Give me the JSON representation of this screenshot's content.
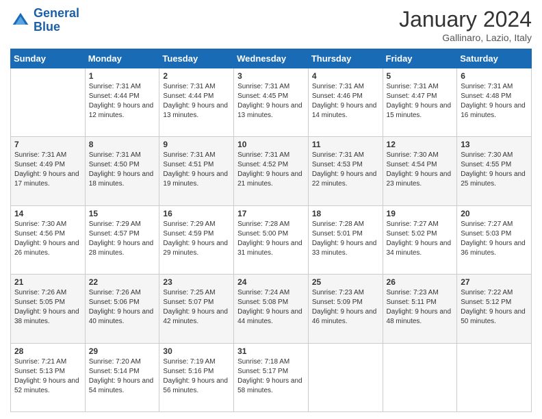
{
  "logo": {
    "line1": "General",
    "line2": "Blue"
  },
  "header": {
    "title": "January 2024",
    "subtitle": "Gallinaro, Lazio, Italy"
  },
  "weekdays": [
    "Sunday",
    "Monday",
    "Tuesday",
    "Wednesday",
    "Thursday",
    "Friday",
    "Saturday"
  ],
  "weeks": [
    [
      {
        "day": "",
        "sunrise": "",
        "sunset": "",
        "daylight": ""
      },
      {
        "day": "1",
        "sunrise": "Sunrise: 7:31 AM",
        "sunset": "Sunset: 4:44 PM",
        "daylight": "Daylight: 9 hours and 12 minutes."
      },
      {
        "day": "2",
        "sunrise": "Sunrise: 7:31 AM",
        "sunset": "Sunset: 4:44 PM",
        "daylight": "Daylight: 9 hours and 13 minutes."
      },
      {
        "day": "3",
        "sunrise": "Sunrise: 7:31 AM",
        "sunset": "Sunset: 4:45 PM",
        "daylight": "Daylight: 9 hours and 13 minutes."
      },
      {
        "day": "4",
        "sunrise": "Sunrise: 7:31 AM",
        "sunset": "Sunset: 4:46 PM",
        "daylight": "Daylight: 9 hours and 14 minutes."
      },
      {
        "day": "5",
        "sunrise": "Sunrise: 7:31 AM",
        "sunset": "Sunset: 4:47 PM",
        "daylight": "Daylight: 9 hours and 15 minutes."
      },
      {
        "day": "6",
        "sunrise": "Sunrise: 7:31 AM",
        "sunset": "Sunset: 4:48 PM",
        "daylight": "Daylight: 9 hours and 16 minutes."
      }
    ],
    [
      {
        "day": "7",
        "sunrise": "Sunrise: 7:31 AM",
        "sunset": "Sunset: 4:49 PM",
        "daylight": "Daylight: 9 hours and 17 minutes."
      },
      {
        "day": "8",
        "sunrise": "Sunrise: 7:31 AM",
        "sunset": "Sunset: 4:50 PM",
        "daylight": "Daylight: 9 hours and 18 minutes."
      },
      {
        "day": "9",
        "sunrise": "Sunrise: 7:31 AM",
        "sunset": "Sunset: 4:51 PM",
        "daylight": "Daylight: 9 hours and 19 minutes."
      },
      {
        "day": "10",
        "sunrise": "Sunrise: 7:31 AM",
        "sunset": "Sunset: 4:52 PM",
        "daylight": "Daylight: 9 hours and 21 minutes."
      },
      {
        "day": "11",
        "sunrise": "Sunrise: 7:31 AM",
        "sunset": "Sunset: 4:53 PM",
        "daylight": "Daylight: 9 hours and 22 minutes."
      },
      {
        "day": "12",
        "sunrise": "Sunrise: 7:30 AM",
        "sunset": "Sunset: 4:54 PM",
        "daylight": "Daylight: 9 hours and 23 minutes."
      },
      {
        "day": "13",
        "sunrise": "Sunrise: 7:30 AM",
        "sunset": "Sunset: 4:55 PM",
        "daylight": "Daylight: 9 hours and 25 minutes."
      }
    ],
    [
      {
        "day": "14",
        "sunrise": "Sunrise: 7:30 AM",
        "sunset": "Sunset: 4:56 PM",
        "daylight": "Daylight: 9 hours and 26 minutes."
      },
      {
        "day": "15",
        "sunrise": "Sunrise: 7:29 AM",
        "sunset": "Sunset: 4:57 PM",
        "daylight": "Daylight: 9 hours and 28 minutes."
      },
      {
        "day": "16",
        "sunrise": "Sunrise: 7:29 AM",
        "sunset": "Sunset: 4:59 PM",
        "daylight": "Daylight: 9 hours and 29 minutes."
      },
      {
        "day": "17",
        "sunrise": "Sunrise: 7:28 AM",
        "sunset": "Sunset: 5:00 PM",
        "daylight": "Daylight: 9 hours and 31 minutes."
      },
      {
        "day": "18",
        "sunrise": "Sunrise: 7:28 AM",
        "sunset": "Sunset: 5:01 PM",
        "daylight": "Daylight: 9 hours and 33 minutes."
      },
      {
        "day": "19",
        "sunrise": "Sunrise: 7:27 AM",
        "sunset": "Sunset: 5:02 PM",
        "daylight": "Daylight: 9 hours and 34 minutes."
      },
      {
        "day": "20",
        "sunrise": "Sunrise: 7:27 AM",
        "sunset": "Sunset: 5:03 PM",
        "daylight": "Daylight: 9 hours and 36 minutes."
      }
    ],
    [
      {
        "day": "21",
        "sunrise": "Sunrise: 7:26 AM",
        "sunset": "Sunset: 5:05 PM",
        "daylight": "Daylight: 9 hours and 38 minutes."
      },
      {
        "day": "22",
        "sunrise": "Sunrise: 7:26 AM",
        "sunset": "Sunset: 5:06 PM",
        "daylight": "Daylight: 9 hours and 40 minutes."
      },
      {
        "day": "23",
        "sunrise": "Sunrise: 7:25 AM",
        "sunset": "Sunset: 5:07 PM",
        "daylight": "Daylight: 9 hours and 42 minutes."
      },
      {
        "day": "24",
        "sunrise": "Sunrise: 7:24 AM",
        "sunset": "Sunset: 5:08 PM",
        "daylight": "Daylight: 9 hours and 44 minutes."
      },
      {
        "day": "25",
        "sunrise": "Sunrise: 7:23 AM",
        "sunset": "Sunset: 5:09 PM",
        "daylight": "Daylight: 9 hours and 46 minutes."
      },
      {
        "day": "26",
        "sunrise": "Sunrise: 7:23 AM",
        "sunset": "Sunset: 5:11 PM",
        "daylight": "Daylight: 9 hours and 48 minutes."
      },
      {
        "day": "27",
        "sunrise": "Sunrise: 7:22 AM",
        "sunset": "Sunset: 5:12 PM",
        "daylight": "Daylight: 9 hours and 50 minutes."
      }
    ],
    [
      {
        "day": "28",
        "sunrise": "Sunrise: 7:21 AM",
        "sunset": "Sunset: 5:13 PM",
        "daylight": "Daylight: 9 hours and 52 minutes."
      },
      {
        "day": "29",
        "sunrise": "Sunrise: 7:20 AM",
        "sunset": "Sunset: 5:14 PM",
        "daylight": "Daylight: 9 hours and 54 minutes."
      },
      {
        "day": "30",
        "sunrise": "Sunrise: 7:19 AM",
        "sunset": "Sunset: 5:16 PM",
        "daylight": "Daylight: 9 hours and 56 minutes."
      },
      {
        "day": "31",
        "sunrise": "Sunrise: 7:18 AM",
        "sunset": "Sunset: 5:17 PM",
        "daylight": "Daylight: 9 hours and 58 minutes."
      },
      {
        "day": "",
        "sunrise": "",
        "sunset": "",
        "daylight": ""
      },
      {
        "day": "",
        "sunrise": "",
        "sunset": "",
        "daylight": ""
      },
      {
        "day": "",
        "sunrise": "",
        "sunset": "",
        "daylight": ""
      }
    ]
  ]
}
